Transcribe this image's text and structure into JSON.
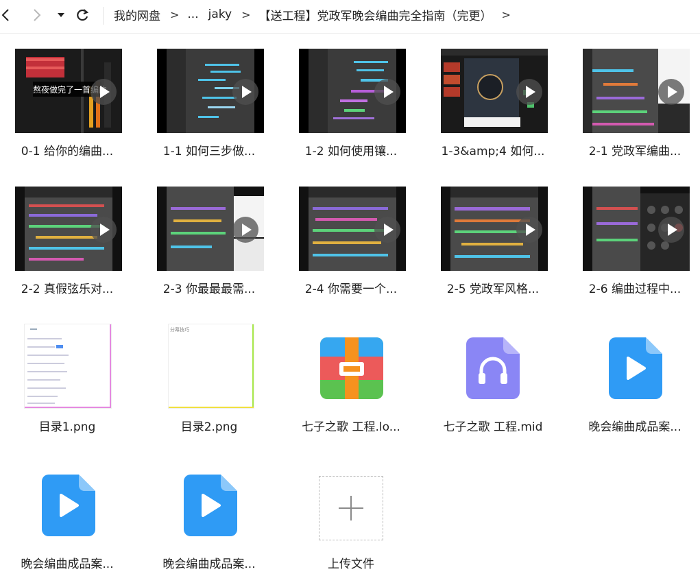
{
  "nav": {
    "back_icon": "chevron-left-icon",
    "forward_icon": "chevron-right-icon",
    "dropdown_icon": "caret-down-icon",
    "refresh_icon": "refresh-icon"
  },
  "breadcrumb": [
    "我的网盘",
    "...",
    "jaky",
    "【送工程】党政军晚会编曲完全指南（完更）"
  ],
  "files": [
    {
      "name": "0-1 给你的编曲...",
      "kind": "video",
      "overlay_text": "熬夜做完了一首编曲"
    },
    {
      "name": "1-1 如何三步做...",
      "kind": "video"
    },
    {
      "name": "1-2 如何使用镶...",
      "kind": "video"
    },
    {
      "name": "1-3&amp;4 如何...",
      "kind": "video"
    },
    {
      "name": "2-1 党政军编曲...",
      "kind": "video"
    },
    {
      "name": "2-2 真假弦乐对...",
      "kind": "video"
    },
    {
      "name": "2-3 你最最最需...",
      "kind": "video"
    },
    {
      "name": "2-4 你需要一个...",
      "kind": "video"
    },
    {
      "name": "2-5 党政军风格...",
      "kind": "video"
    },
    {
      "name": "2-6 编曲过程中...",
      "kind": "video"
    },
    {
      "name": "目录1.png",
      "kind": "image"
    },
    {
      "name": "目录2.png",
      "kind": "image",
      "doc_text": "分幕技巧"
    },
    {
      "name": "七子之歌 工程.lo...",
      "kind": "archive",
      "icon": "archive-icon"
    },
    {
      "name": "七子之歌 工程.mid",
      "kind": "audio",
      "icon": "headphones-icon"
    },
    {
      "name": "晚会编曲成品案...",
      "kind": "video-file",
      "icon": "play-file-icon"
    },
    {
      "name": "晚会编曲成品案...",
      "kind": "video-file",
      "icon": "play-file-icon"
    },
    {
      "name": "晚会编曲成品案...",
      "kind": "video-file",
      "icon": "play-file-icon"
    }
  ],
  "upload": {
    "label": "上传文件",
    "icon": "plus-icon"
  },
  "colors": {
    "accent_blue": "#2f9bf5",
    "archive_red": "#ec5a5a",
    "archive_green": "#5bc250",
    "archive_orange": "#f6921e",
    "audio_purple": "#8a86f5"
  }
}
